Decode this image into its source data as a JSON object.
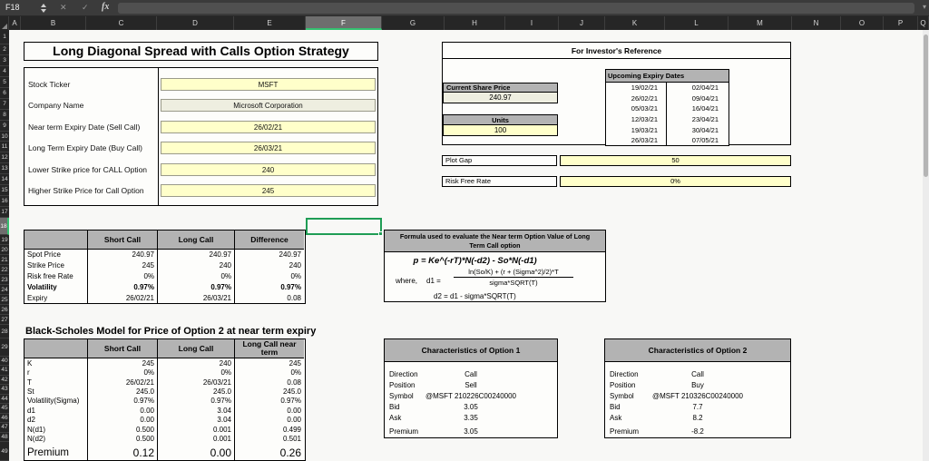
{
  "formula_bar": {
    "cell_ref": "F18",
    "formula": "",
    "fx": "fx",
    "cancel": "✕",
    "enter": "✓"
  },
  "grid": {
    "columns": [
      "A",
      "B",
      "C",
      "D",
      "E",
      "F",
      "G",
      "H",
      "I",
      "J",
      "K",
      "L",
      "M",
      "N",
      "O",
      "P",
      "Q"
    ],
    "selected_column": "F",
    "row_numbers": [
      1,
      2,
      3,
      4,
      5,
      6,
      7,
      8,
      9,
      10,
      11,
      12,
      13,
      14,
      15,
      16,
      17,
      18,
      19,
      20,
      21,
      22,
      23,
      24,
      25,
      26,
      27,
      28,
      29,
      40,
      41,
      42,
      43,
      44,
      45,
      46,
      47,
      48,
      49
    ],
    "selected_row": 18
  },
  "title": "Long Diagonal Spread with Calls Option Strategy",
  "inputs": [
    {
      "label": "Stock Ticker",
      "value": "MSFT",
      "fill": "yellow"
    },
    {
      "label": "Company Name",
      "value": "Microsoft Corporation",
      "fill": "tan"
    },
    {
      "label": "Near term Expiry Date (Sell Call)",
      "value": "26/02/21",
      "fill": "yellow"
    },
    {
      "label": "Long Term Expiry Date (Buy Call)",
      "value": "26/03/21",
      "fill": "yellow"
    },
    {
      "label": "Lower Strike price for CALL Option",
      "value": "240",
      "fill": "yellow"
    },
    {
      "label": "Higher Strike Price for Call Option",
      "value": "245",
      "fill": "yellow"
    }
  ],
  "reference": {
    "title": "For Investor's Reference",
    "share_price_label": "Current Share Price",
    "share_price": "240.97",
    "units_label": "Units",
    "units": "100",
    "expiry_header": "Upcoming Expiry Dates",
    "expiry_dates": [
      [
        "19/02/21",
        "02/04/21"
      ],
      [
        "26/02/21",
        "09/04/21"
      ],
      [
        "05/03/21",
        "16/04/21"
      ],
      [
        "12/03/21",
        "23/04/21"
      ],
      [
        "19/03/21",
        "30/04/21"
      ],
      [
        "26/03/21",
        "07/05/21"
      ]
    ],
    "plot_gap_label": "Plot Gap",
    "plot_gap": "50",
    "risk_free_label": "Risk Free Rate",
    "risk_free": "0%"
  },
  "comparison": {
    "headers": [
      "Short Call",
      "Long Call",
      "Difference"
    ],
    "rows": [
      {
        "label": "Spot Price",
        "values": [
          "240.97",
          "240.97",
          "240.97"
        ],
        "bold": false
      },
      {
        "label": "Strike Price",
        "values": [
          "245",
          "240",
          "240"
        ],
        "bold": false
      },
      {
        "label": "Risk free Rate",
        "values": [
          "0%",
          "0%",
          "0%"
        ],
        "bold": false
      },
      {
        "label": "Volatility",
        "values": [
          "0.97%",
          "0.97%",
          "0.97%"
        ],
        "bold": true
      },
      {
        "label": "Expiry",
        "values": [
          "26/02/21",
          "26/03/21",
          "0.08"
        ],
        "bold": false
      }
    ]
  },
  "formula_box": {
    "header": "Formula used to evaluate the Near term Option Value of Long Term Call option",
    "formula": "p  = Ke^(-rT)*N(-d2) - So*N(-d1)",
    "where_label": "where,",
    "d1_label": "d1 =",
    "d1_numerator": "ln(So/K) + (r + (Sigma^2)/2)*T",
    "d1_denominator": "sigma*SQRT(T)",
    "d2_line": "d2 =  d1 - sigma*SQRT(T)"
  },
  "bs": {
    "title": "Black-Scholes Model for Price of Option 2 at near term expiry",
    "headers": [
      "Short Call",
      "Long Call",
      "Long Call near term"
    ],
    "rows": [
      {
        "label": "K",
        "values": [
          "245",
          "240",
          "245"
        ]
      },
      {
        "label": "r",
        "values": [
          "0%",
          "0%",
          "0%"
        ]
      },
      {
        "label": "T",
        "values": [
          "26/02/21",
          "26/03/21",
          "0.08"
        ]
      },
      {
        "label": "St",
        "values": [
          "245.0",
          "245.0",
          "245.0"
        ]
      },
      {
        "label": "Volatility(Sigma)",
        "values": [
          "0.97%",
          "0.97%",
          "0.97%"
        ]
      },
      {
        "label": "d1",
        "values": [
          "0.00",
          "3.04",
          "0.00"
        ]
      },
      {
        "label": "d2",
        "values": [
          "0.00",
          "3.04",
          "0.00"
        ]
      },
      {
        "label": "N(d1)",
        "values": [
          "0.500",
          "0.001",
          "0.499"
        ]
      },
      {
        "label": "N(d2)",
        "values": [
          "0.500",
          "0.001",
          "0.501"
        ]
      }
    ],
    "premium": {
      "label": "Premium",
      "values": [
        "0.12",
        "0.00",
        "0.26"
      ]
    }
  },
  "option1": {
    "title": "Characteristics of Option 1",
    "rows": [
      {
        "label": "Direction",
        "value": "Call"
      },
      {
        "label": "Position",
        "value": "Sell"
      },
      {
        "label": "Symbol",
        "value": "@MSFT 210226C00240000"
      },
      {
        "label": "Bid",
        "value": "3.05"
      },
      {
        "label": "Ask",
        "value": "3.35"
      }
    ],
    "premium": {
      "label": "Premium",
      "value": "3.05"
    }
  },
  "option2": {
    "title": "Characteristics of Option 2",
    "rows": [
      {
        "label": "Direction",
        "value": "Call"
      },
      {
        "label": "Position",
        "value": "Buy"
      },
      {
        "label": "Symbol",
        "value": "@MSFT 210326C00240000"
      },
      {
        "label": "Bid",
        "value": "7.7"
      },
      {
        "label": "Ask",
        "value": "8.2"
      }
    ],
    "premium": {
      "label": "Premium",
      "value": "-8.2"
    }
  },
  "colors": {
    "input_yellow": "#ffffca",
    "input_tan": "#eeeee0",
    "header_gray": "#b3b3b3",
    "selection_green": "#1f9d55"
  }
}
